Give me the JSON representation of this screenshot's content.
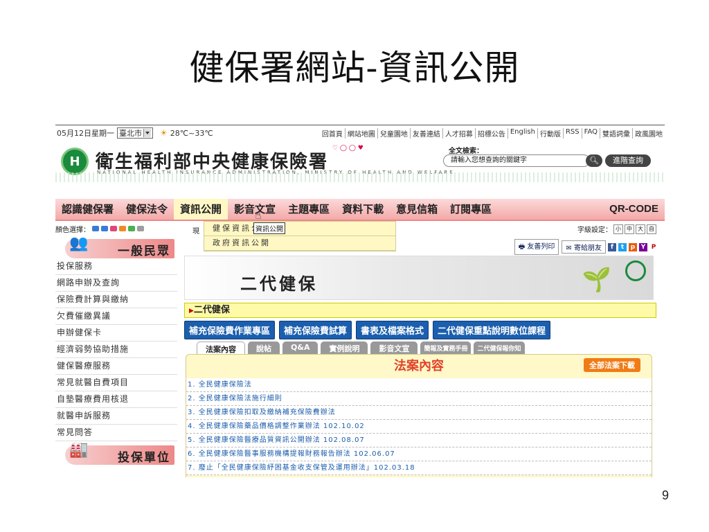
{
  "slide": {
    "title": "健保署網站-資訊公開",
    "page_number": "9"
  },
  "topbar": {
    "date": "05月12日星期一",
    "city": "臺北市",
    "temperature": "28℃~33℃",
    "links": [
      "回首頁",
      "網站地圖",
      "兒童園地",
      "友善連結",
      "人才招募",
      "招標公告",
      "English",
      "行動版",
      "RSS",
      "FAQ",
      "雙語詞彙",
      "政風園地"
    ]
  },
  "header": {
    "org_name": "衛生福利部中央健康保險署",
    "org_en": "NATIONAL HEALTH INSURANCE ADMINISTRATION, MINISTRY OF HEALTH AND WELFARE",
    "search_label": "全文檢索：",
    "search_placeholder": "請輸入您想查詢的關鍵字",
    "advanced_search": "進階查詢"
  },
  "nav": {
    "items": [
      "認識健保署",
      "健保法令",
      "資訊公開",
      "影音文宣",
      "主題專區",
      "資料下載",
      "意見信箱",
      "訂閱專區",
      "QR-CODE"
    ],
    "active_index": 2,
    "dropdown": [
      "健保資訊公開",
      "政府資訊公開"
    ],
    "tooltip": "資訊公開"
  },
  "left": {
    "color_label": "顏色選擇：",
    "colors": [
      "#3a7bd5",
      "#3a7bd5",
      "#e0457b",
      "#f08a24",
      "#4caf50",
      "#9e9e9e"
    ],
    "category1": "一般民眾",
    "menu": [
      "投保服務",
      "網路申辦及查詢",
      "保險費計算與繳納",
      "欠費催繳異議",
      "申辦健保卡",
      "經濟弱勢協助措施",
      "健保醫療服務",
      "常見就醫自費項目",
      "自墊醫療費用核退",
      "就醫申訴服務",
      "常見問答"
    ],
    "category2": "投保單位"
  },
  "content": {
    "breadcrumb_prefix": "現",
    "font_setting": "字級設定：",
    "font_buttons": [
      "小",
      "中",
      "大",
      "自"
    ],
    "print_label": "友善列印",
    "send_label": "寄給朋友",
    "banner_title": "二代健保",
    "sub_title": "二代健保",
    "blue_buttons": [
      "補充保險費作業專區",
      "補充保險費試算",
      "書表及檔案格式",
      "二代健保重點說明數位課程"
    ],
    "tabs": [
      "法案內容",
      "說帖",
      "Q&A",
      "實例說明",
      "影音文宣",
      "簡報及實務手冊",
      "二代健保報你知"
    ],
    "panel_title": "法案內容",
    "download_all": "全部法案下載",
    "laws": [
      "1. 全民健康保險法",
      "2. 全民健康保險法施行細則",
      "3. 全民健康保險扣取及繳納補充保險費辦法",
      "4. 全民健康保險藥品價格調整作業辦法 102.10.02",
      "5. 全民健康保險醫療品質資訊公開辦法 102.08.07",
      "6. 全民健康保險醫事服務機構提報財務報告辦法 102.06.07",
      "7. 廢止「全民健康保險紓困基金收支保管及運用辦法」102.03.18"
    ]
  }
}
